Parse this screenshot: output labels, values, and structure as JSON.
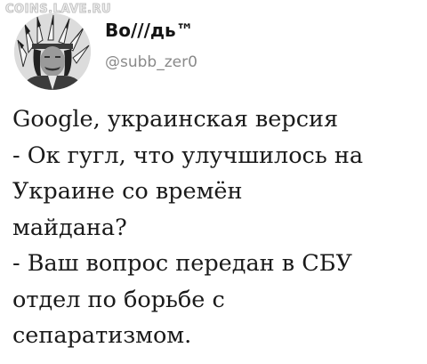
{
  "watermark": "COINS.LAVE.RU",
  "author": {
    "display_name": "Во///дь™",
    "handle": "@subb_zer0"
  },
  "tweet": {
    "lines": [
      "Google, украинская версия",
      "- Ок гугл, что улучшилось на",
      "Украине со времён",
      "майдана?",
      "- Ваш вопрос передан в СБУ",
      "отдел по борьбе с",
      "сепаратизмом."
    ]
  }
}
